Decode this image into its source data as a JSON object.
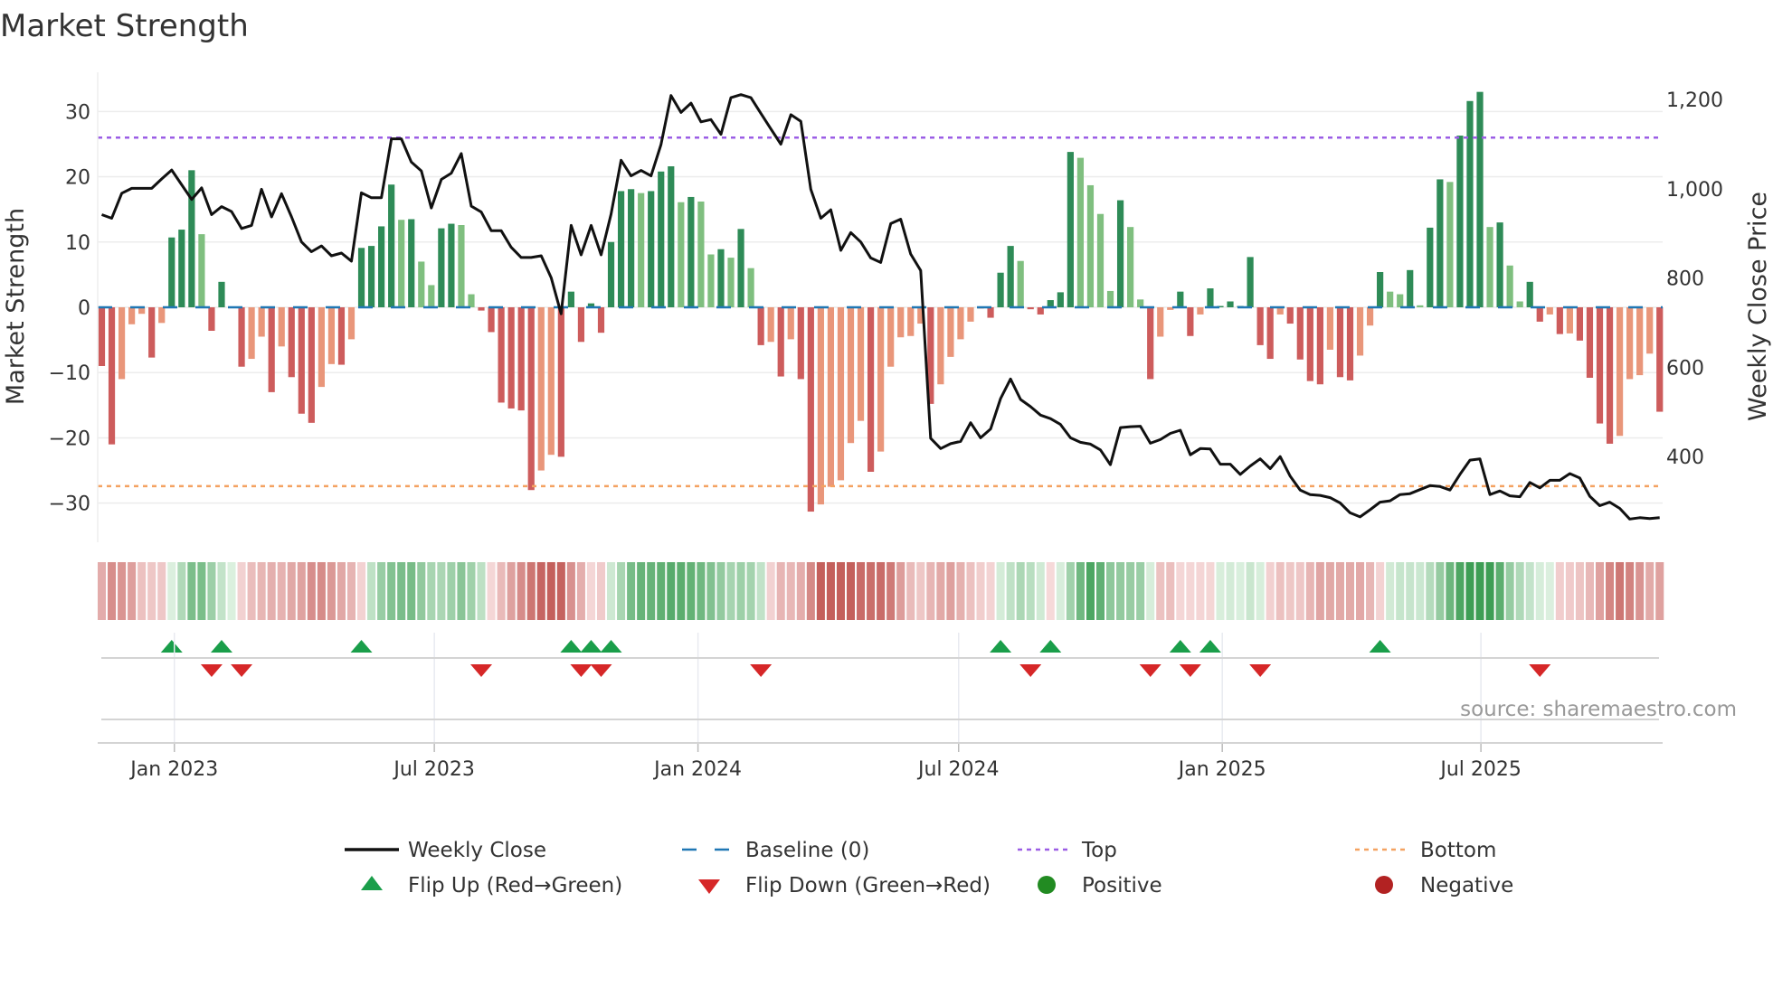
{
  "chart_data": {
    "type": "bar",
    "title": "Market Strength",
    "ylabel": "Market Strength",
    "y2label": "Weekly Close Price",
    "source": "source: sharemaestro.com",
    "ylim": [
      -36,
      36
    ],
    "y2lim": [
      208,
      1261
    ],
    "yticks": [
      30,
      20,
      10,
      0,
      -10,
      -20,
      -30
    ],
    "yticklabels": [
      "30",
      "20",
      "10",
      "0",
      "−10",
      "−20",
      "−30"
    ],
    "y2ticks": [
      1200,
      1000,
      800,
      600,
      400
    ],
    "y2ticklabels": [
      "1,200",
      "1,000",
      "800",
      "600",
      "400"
    ],
    "x_ticks": [
      {
        "label": "Jan 2023",
        "week": 7.27
      },
      {
        "label": "Jul 2023",
        "week": 33.3
      },
      {
        "label": "Jan 2024",
        "week": 59.7
      },
      {
        "label": "Jul 2024",
        "week": 85.8
      },
      {
        "label": "Jan 2025",
        "week": 112.2
      },
      {
        "label": "Jul 2025",
        "week": 138.1
      }
    ],
    "top_level": 26,
    "bottom_level": -27.4,
    "baseline": 0,
    "strength": [
      -9,
      -21,
      -11,
      -2.6,
      -1,
      -7.7,
      -2.4,
      10.7,
      11.9,
      21,
      11.2,
      -3.6,
      3.9,
      0,
      -9.1,
      -7.9,
      -4.5,
      -13,
      -6,
      -10.7,
      -16.3,
      -17.7,
      -12.2,
      -8.7,
      -8.8,
      -4.9,
      9.1,
      9.4,
      12.4,
      18.8,
      13.4,
      13.5,
      7,
      3.4,
      12.1,
      12.8,
      12.6,
      2,
      -0.5,
      -3.8,
      -14.6,
      -15.5,
      -15.8,
      -28,
      -25,
      -22.6,
      -22.9,
      2.4,
      -5.3,
      0.6,
      -3.9,
      10,
      17.8,
      18.1,
      17.5,
      17.8,
      20.8,
      21.6,
      16.1,
      16.9,
      16.2,
      8.1,
      8.9,
      7.6,
      12,
      6,
      -5.8,
      -5.3,
      -10.6,
      -4.9,
      -11,
      -31.3,
      -30.2,
      -27.5,
      -26.5,
      -20.8,
      -17.4,
      -25.2,
      -22.1,
      -9.1,
      -4.6,
      -4.4,
      -2.5,
      -14.8,
      -11.8,
      -7.6,
      -4.9,
      -2.2,
      -0.2,
      -1.6,
      5.3,
      9.4,
      7.1,
      -0.3,
      -1.1,
      1.1,
      2.3,
      23.8,
      22.9,
      18.7,
      14.3,
      2.5,
      16.4,
      12.3,
      1.2,
      -11,
      -4.5,
      -0.4,
      2.4,
      -4.4,
      -1.1,
      2.9,
      0.2,
      0.9,
      0.2,
      7.7,
      -5.8,
      -7.9,
      -1.1,
      -2.5,
      -8,
      -11.3,
      -11.8,
      -6.5,
      -10.7,
      -11.2,
      -7.4,
      -2.8,
      5.4,
      2.4,
      2,
      5.7,
      0.3,
      12.2,
      19.6,
      19.2,
      26.3,
      31.6,
      33,
      12.3,
      13,
      6.4,
      0.9,
      3.9,
      -2.2,
      -1.1,
      -4.1,
      -4,
      -5.1,
      -10.8,
      -17.8,
      -20.9,
      -19.7,
      -11,
      -10.4,
      -7.1,
      -16
    ],
    "strong": [
      1,
      1,
      0,
      0,
      0,
      1,
      0,
      1,
      1,
      1,
      0,
      1,
      1,
      1,
      1,
      0,
      0,
      1,
      0,
      1,
      1,
      1,
      0,
      0,
      1,
      0,
      1,
      1,
      1,
      1,
      0,
      1,
      0,
      0,
      1,
      1,
      0,
      0,
      1,
      1,
      1,
      1,
      1,
      1,
      0,
      0,
      1,
      1,
      1,
      1,
      1,
      1,
      1,
      1,
      0,
      1,
      1,
      1,
      0,
      1,
      0,
      0,
      1,
      0,
      1,
      0,
      1,
      0,
      1,
      0,
      1,
      1,
      0,
      0,
      0,
      0,
      0,
      1,
      0,
      0,
      0,
      0,
      0,
      1,
      0,
      0,
      0,
      0,
      0,
      1,
      1,
      1,
      0,
      1,
      1,
      1,
      1,
      1,
      0,
      0,
      0,
      0,
      1,
      0,
      0,
      1,
      0,
      0,
      1,
      1,
      0,
      1,
      1,
      1,
      1,
      1,
      1,
      1,
      0,
      1,
      1,
      1,
      1,
      0,
      1,
      1,
      0,
      0,
      1,
      0,
      0,
      1,
      0,
      1,
      1,
      0,
      1,
      1,
      1,
      0,
      1,
      0,
      0,
      1,
      1,
      0,
      1,
      0,
      1,
      1,
      1,
      1,
      0,
      0,
      0,
      0,
      1
    ],
    "weekly_close": [
      942,
      934,
      990,
      1001,
      1001,
      1001,
      1022,
      1042,
      1009,
      976,
      1002,
      942,
      960,
      949,
      911,
      918,
      999,
      937,
      989,
      937,
      881,
      859,
      872,
      850,
      856,
      838,
      991,
      980,
      980,
      1112,
      1112,
      1060,
      1040,
      957,
      1021,
      1035,
      1079,
      961,
      948,
      906,
      906,
      869,
      846,
      846,
      850,
      801,
      720,
      918,
      852,
      918,
      852,
      943,
      1064,
      1029,
      1041,
      1029,
      1099,
      1209,
      1171,
      1192,
      1150,
      1155,
      1122,
      1204,
      1211,
      1204,
      1169,
      1134,
      1100,
      1166,
      1151,
      999,
      934,
      953,
      862,
      902,
      881,
      845,
      835,
      922,
      932,
      854,
      817,
      441,
      418,
      429,
      434,
      476,
      442,
      462,
      530,
      574,
      528,
      512,
      493,
      485,
      472,
      442,
      432,
      428,
      415,
      382,
      465,
      467,
      468,
      430,
      438,
      452,
      459,
      404,
      418,
      417,
      383,
      383,
      360,
      379,
      395,
      373,
      400,
      356,
      325,
      315,
      313,
      308,
      296,
      274,
      265,
      281,
      298,
      301,
      315,
      317,
      326,
      335,
      333,
      325,
      360,
      392,
      395,
      315,
      323,
      312,
      310,
      342,
      330,
      347,
      347,
      362,
      352,
      311,
      290,
      298,
      284,
      260,
      263,
      261,
      263
    ],
    "flip_up_weeks": [
      7,
      12,
      26,
      47,
      49,
      51,
      90,
      95,
      108,
      111,
      128
    ],
    "flip_down_weeks": [
      11,
      14,
      38,
      48,
      50,
      66,
      93,
      105,
      109,
      116,
      144
    ],
    "legend": [
      {
        "key": "close",
        "label": "Weekly Close"
      },
      {
        "key": "baseline",
        "label": "Baseline (0)"
      },
      {
        "key": "top",
        "label": "Top"
      },
      {
        "key": "bottom",
        "label": "Bottom"
      },
      {
        "key": "flip_up",
        "label": "Flip Up (Red→Green)"
      },
      {
        "key": "flip_down",
        "label": "Flip Down (Green→Red)"
      },
      {
        "key": "positive",
        "label": "Positive"
      },
      {
        "key": "negative",
        "label": "Negative"
      }
    ],
    "legend_placement": "bottom",
    "colors": {
      "pos_strong": "#2e8b57",
      "pos_weak": "#7fbf7f",
      "neg_strong": "#cd5c5c",
      "neg_weak": "#e9967a",
      "close": "#111111",
      "baseline": "#1f77b4",
      "top": "#9b5de5",
      "bottom": "#f4a261",
      "flip_up": "#1a9e4a",
      "flip_down": "#d62728",
      "positive": "#228b22",
      "negative": "#b22222"
    }
  }
}
